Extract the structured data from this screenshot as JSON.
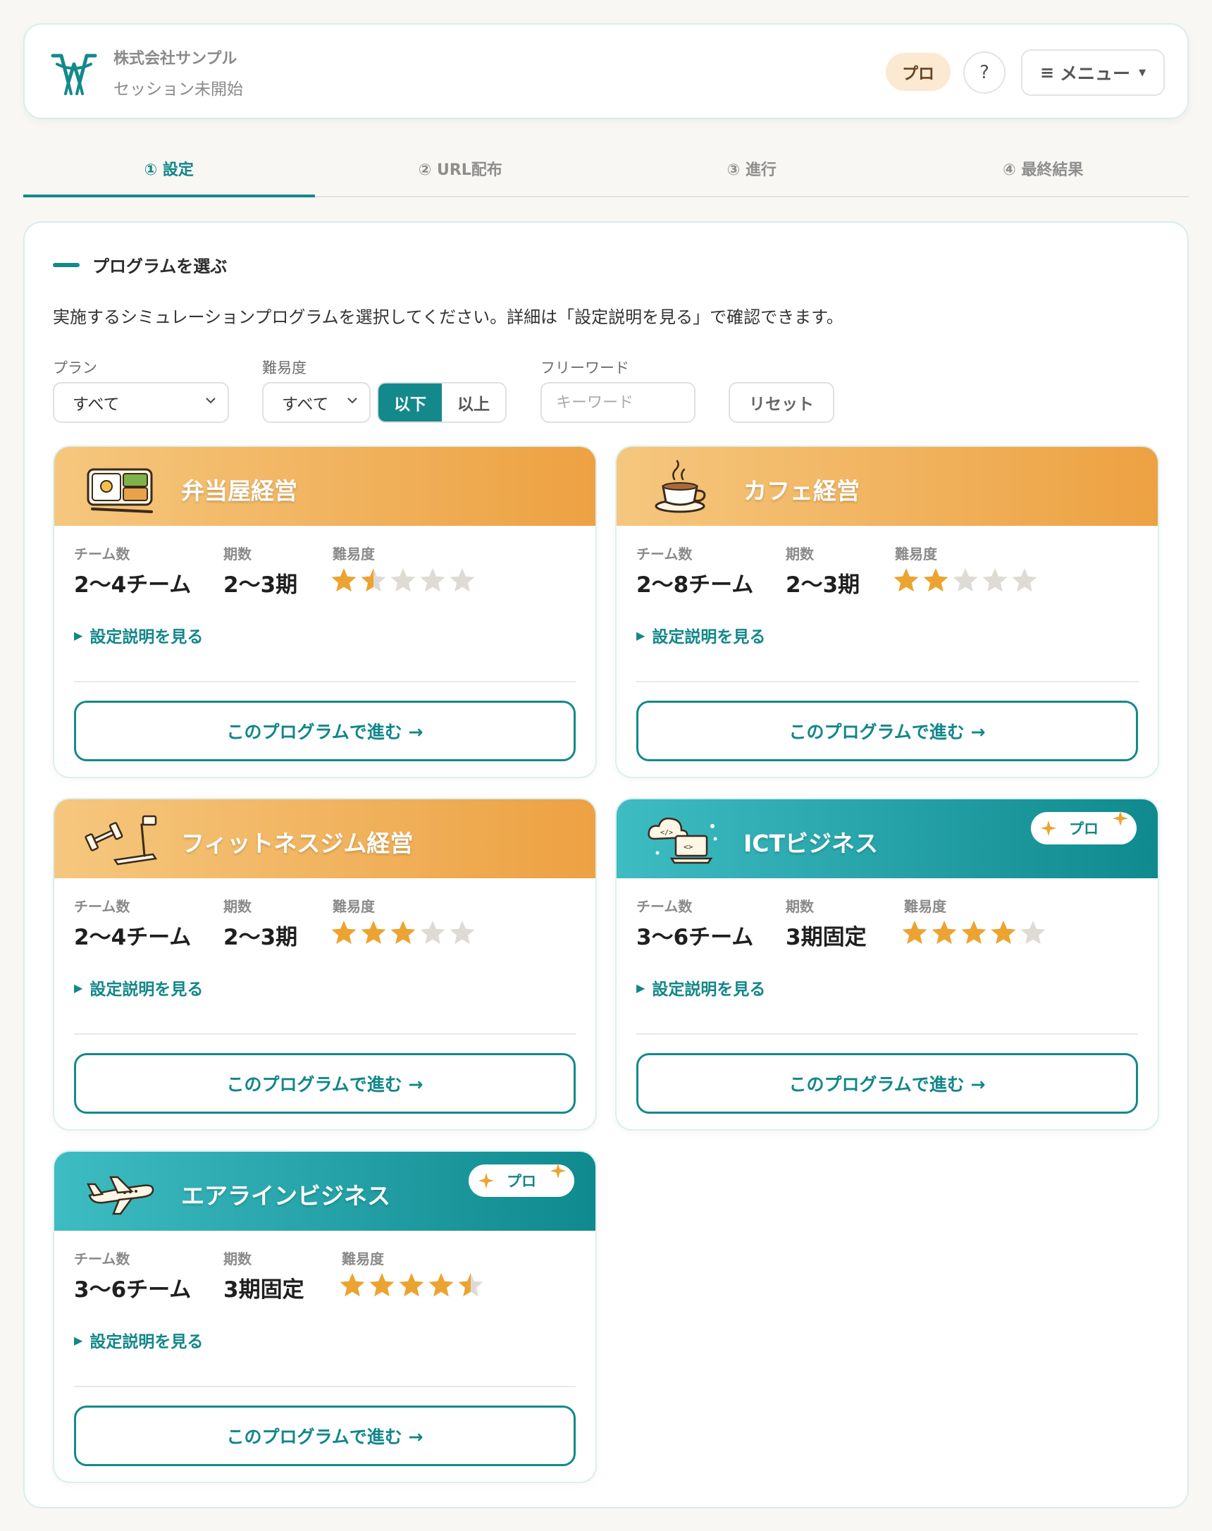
{
  "header": {
    "company": "株式会社サンプル",
    "session_status": "セッション未開始",
    "plan_badge": "プロ",
    "help_label": "?",
    "menu_label": "メニュー"
  },
  "steps": [
    {
      "label": "① 設定",
      "active": true
    },
    {
      "label": "② URL配布",
      "active": false
    },
    {
      "label": "③ 進行",
      "active": false
    },
    {
      "label": "④ 最終結果",
      "active": false
    }
  ],
  "section": {
    "title": "プログラムを選ぶ",
    "intro": "実施するシミュレーションプログラムを選択してください。詳細は「設定説明を見る」で確認できます。"
  },
  "filters": {
    "plan_label": "プラン",
    "plan_value": "すべて",
    "difficulty_label": "難易度",
    "difficulty_value": "すべて",
    "compare_options": [
      "以下",
      "以上"
    ],
    "compare_selected": "以下",
    "keyword_label": "フリーワード",
    "keyword_placeholder": "キーワード",
    "reset_label": "リセット"
  },
  "card_labels": {
    "teams": "チーム数",
    "periods": "期数",
    "difficulty": "難易度",
    "detail_link": "設定説明を見る",
    "proceed": "このプログラムで進む →",
    "pro_chip": "プロ"
  },
  "programs": [
    {
      "title": "弁当屋経営",
      "icon": "bento-box-icon",
      "theme": "orange",
      "teams": "2〜4チーム",
      "periods": "2〜3期",
      "difficulty": 1.5,
      "pro": false
    },
    {
      "title": "カフェ経営",
      "icon": "coffee-cup-icon",
      "theme": "orange",
      "teams": "2〜8チーム",
      "periods": "2〜3期",
      "difficulty": 2,
      "pro": false
    },
    {
      "title": "フィットネスジム経営",
      "icon": "dumbbell-treadmill-icon",
      "theme": "orange",
      "teams": "2〜4チーム",
      "periods": "2〜3期",
      "difficulty": 3,
      "pro": false
    },
    {
      "title": "ICTビジネス",
      "icon": "cloud-laptop-icon",
      "theme": "teal",
      "teams": "3〜6チーム",
      "periods": "3期固定",
      "difficulty": 4,
      "pro": true
    },
    {
      "title": "エアラインビジネス",
      "icon": "airplane-icon",
      "theme": "teal",
      "teams": "3〜6チーム",
      "periods": "3期固定",
      "difficulty": 4.5,
      "pro": true
    }
  ],
  "colors": {
    "accent": "#14898c",
    "orange_start": "#f5c77e",
    "orange_end": "#eda142",
    "teal_start": "#3dbcc2",
    "teal_end": "#0f8a8e",
    "star_on": "#eba432",
    "star_off": "#dedbd4"
  }
}
